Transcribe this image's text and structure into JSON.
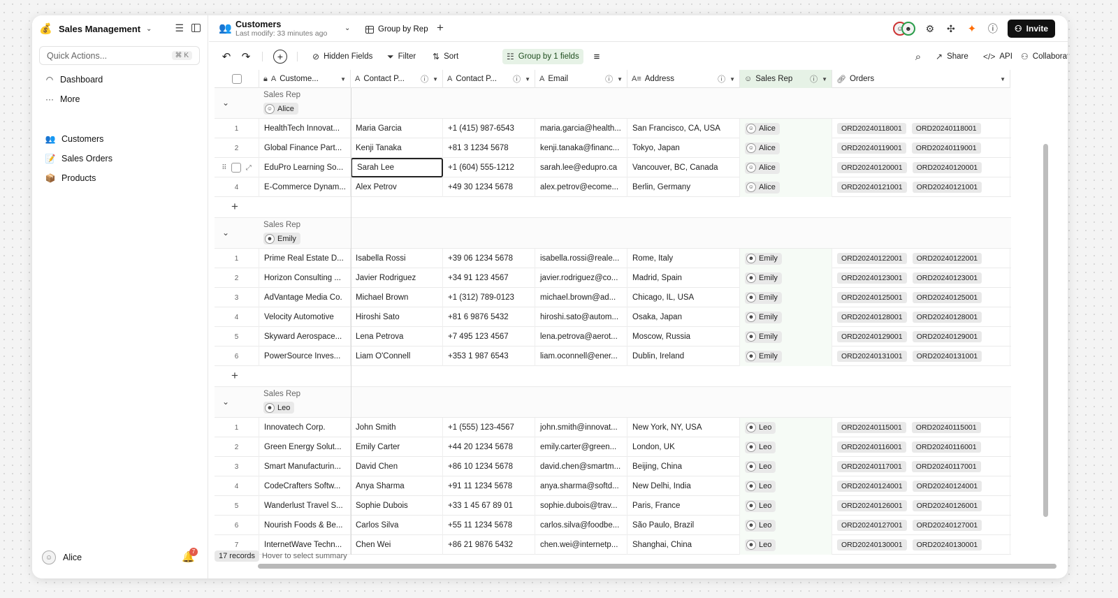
{
  "sidebar": {
    "workspace": "Sales Management",
    "quick_actions": "Quick Actions...",
    "quick_shortcut": "⌘ K",
    "links": [
      {
        "label": "Dashboard",
        "icon": "dashboard-icon"
      },
      {
        "label": "More",
        "icon": "more-icon"
      }
    ],
    "tables": [
      {
        "label": "Customers",
        "icon": "👥"
      },
      {
        "label": "Sales Orders",
        "icon": "📝"
      },
      {
        "label": "Products",
        "icon": "📦"
      }
    ],
    "user": "Alice",
    "notification_count": "7"
  },
  "topbar": {
    "table_name": "Customers",
    "last_modify": "Last modify: 33 minutes ago",
    "view_name": "Group by Rep",
    "invite": "Invite"
  },
  "toolbar": {
    "hidden_fields": "Hidden Fields",
    "filter": "Filter",
    "sort": "Sort",
    "group": "Group by 1 fields",
    "share": "Share",
    "api": "API",
    "collaborative": "Collaborative"
  },
  "columns": [
    "Custome...",
    "Contact P...",
    "Contact P...",
    "Email",
    "Address",
    "Sales Rep",
    "Orders"
  ],
  "groups": [
    {
      "label": "Sales Rep",
      "rep": "Alice",
      "rows": [
        {
          "n": "1",
          "c": "HealthTech Innovat...",
          "p": "Maria Garcia",
          "ph": "+1 (415) 987-6543",
          "e": "maria.garcia@health...",
          "a": "San Francisco, CA, USA",
          "r": "Alice",
          "o": "ORD20240118001"
        },
        {
          "n": "2",
          "c": "Global Finance Part...",
          "p": "Kenji Tanaka",
          "ph": "+81 3 1234 5678",
          "e": "kenji.tanaka@financ...",
          "a": "Tokyo, Japan",
          "r": "Alice",
          "o": "ORD20240119001"
        },
        {
          "n": "3",
          "c": "EduPro Learning So...",
          "p": "Sarah Lee",
          "ph": "+1 (604) 555-1212",
          "e": "sarah.lee@edupro.ca",
          "a": "Vancouver, BC, Canada",
          "r": "Alice",
          "o": "ORD20240120001"
        },
        {
          "n": "4",
          "c": "E-Commerce Dynam...",
          "p": "Alex Petrov",
          "ph": "+49 30 1234 5678",
          "e": "alex.petrov@ecome...",
          "a": "Berlin, Germany",
          "r": "Alice",
          "o": "ORD20240121001"
        }
      ]
    },
    {
      "label": "Sales Rep",
      "rep": "Emily",
      "rows": [
        {
          "n": "1",
          "c": "Prime Real Estate D...",
          "p": "Isabella Rossi",
          "ph": "+39 06 1234 5678",
          "e": "isabella.rossi@reale...",
          "a": "Rome, Italy",
          "r": "Emily",
          "o": "ORD20240122001"
        },
        {
          "n": "2",
          "c": "Horizon Consulting ...",
          "p": "Javier Rodriguez",
          "ph": "+34 91 123 4567",
          "e": "javier.rodriguez@co...",
          "a": "Madrid, Spain",
          "r": "Emily",
          "o": "ORD20240123001"
        },
        {
          "n": "3",
          "c": "AdVantage Media Co.",
          "p": "Michael Brown",
          "ph": "+1 (312) 789-0123",
          "e": "michael.brown@ad...",
          "a": "Chicago, IL, USA",
          "r": "Emily",
          "o": "ORD20240125001"
        },
        {
          "n": "4",
          "c": "Velocity Automotive",
          "p": "Hiroshi Sato",
          "ph": "+81 6 9876 5432",
          "e": "hiroshi.sato@autom...",
          "a": "Osaka, Japan",
          "r": "Emily",
          "o": "ORD20240128001"
        },
        {
          "n": "5",
          "c": "Skyward Aerospace...",
          "p": "Lena Petrova",
          "ph": "+7 495 123 4567",
          "e": "lena.petrova@aerot...",
          "a": "Moscow, Russia",
          "r": "Emily",
          "o": "ORD20240129001"
        },
        {
          "n": "6",
          "c": "PowerSource Inves...",
          "p": "Liam O'Connell",
          "ph": "+353 1 987 6543",
          "e": "liam.oconnell@ener...",
          "a": "Dublin, Ireland",
          "r": "Emily",
          "o": "ORD20240131001"
        }
      ]
    },
    {
      "label": "Sales Rep",
      "rep": "Leo",
      "rows": [
        {
          "n": "1",
          "c": "Innovatech Corp.",
          "p": "John Smith",
          "ph": "+1 (555) 123-4567",
          "e": "john.smith@innovat...",
          "a": "New York, NY, USA",
          "r": "Leo",
          "o": "ORD20240115001"
        },
        {
          "n": "2",
          "c": "Green Energy Solut...",
          "p": "Emily Carter",
          "ph": "+44 20 1234 5678",
          "e": "emily.carter@green...",
          "a": "London, UK",
          "r": "Leo",
          "o": "ORD20240116001"
        },
        {
          "n": "3",
          "c": "Smart Manufacturin...",
          "p": "David Chen",
          "ph": "+86 10 1234 5678",
          "e": "david.chen@smartm...",
          "a": "Beijing, China",
          "r": "Leo",
          "o": "ORD20240117001"
        },
        {
          "n": "4",
          "c": "CodeCrafters Softw...",
          "p": "Anya Sharma",
          "ph": "+91 11 1234 5678",
          "e": "anya.sharma@softd...",
          "a": "New Delhi, India",
          "r": "Leo",
          "o": "ORD20240124001"
        },
        {
          "n": "5",
          "c": "Wanderlust Travel S...",
          "p": "Sophie Dubois",
          "ph": "+33 1 45 67 89 01",
          "e": "sophie.dubois@trav...",
          "a": "Paris, France",
          "r": "Leo",
          "o": "ORD20240126001"
        },
        {
          "n": "6",
          "c": "Nourish Foods & Be...",
          "p": "Carlos Silva",
          "ph": "+55 11 1234 5678",
          "e": "carlos.silva@foodbe...",
          "a": "São Paulo, Brazil",
          "r": "Leo",
          "o": "ORD20240127001"
        },
        {
          "n": "7",
          "c": "InternetWave Techn...",
          "p": "Chen Wei",
          "ph": "+86 21 9876 5432",
          "e": "chen.wei@internetp...",
          "a": "Shanghai, China",
          "r": "Leo",
          "o": "ORD20240130001"
        }
      ]
    }
  ],
  "footer": {
    "records": "17 records",
    "hover": "Hover to select summary"
  }
}
